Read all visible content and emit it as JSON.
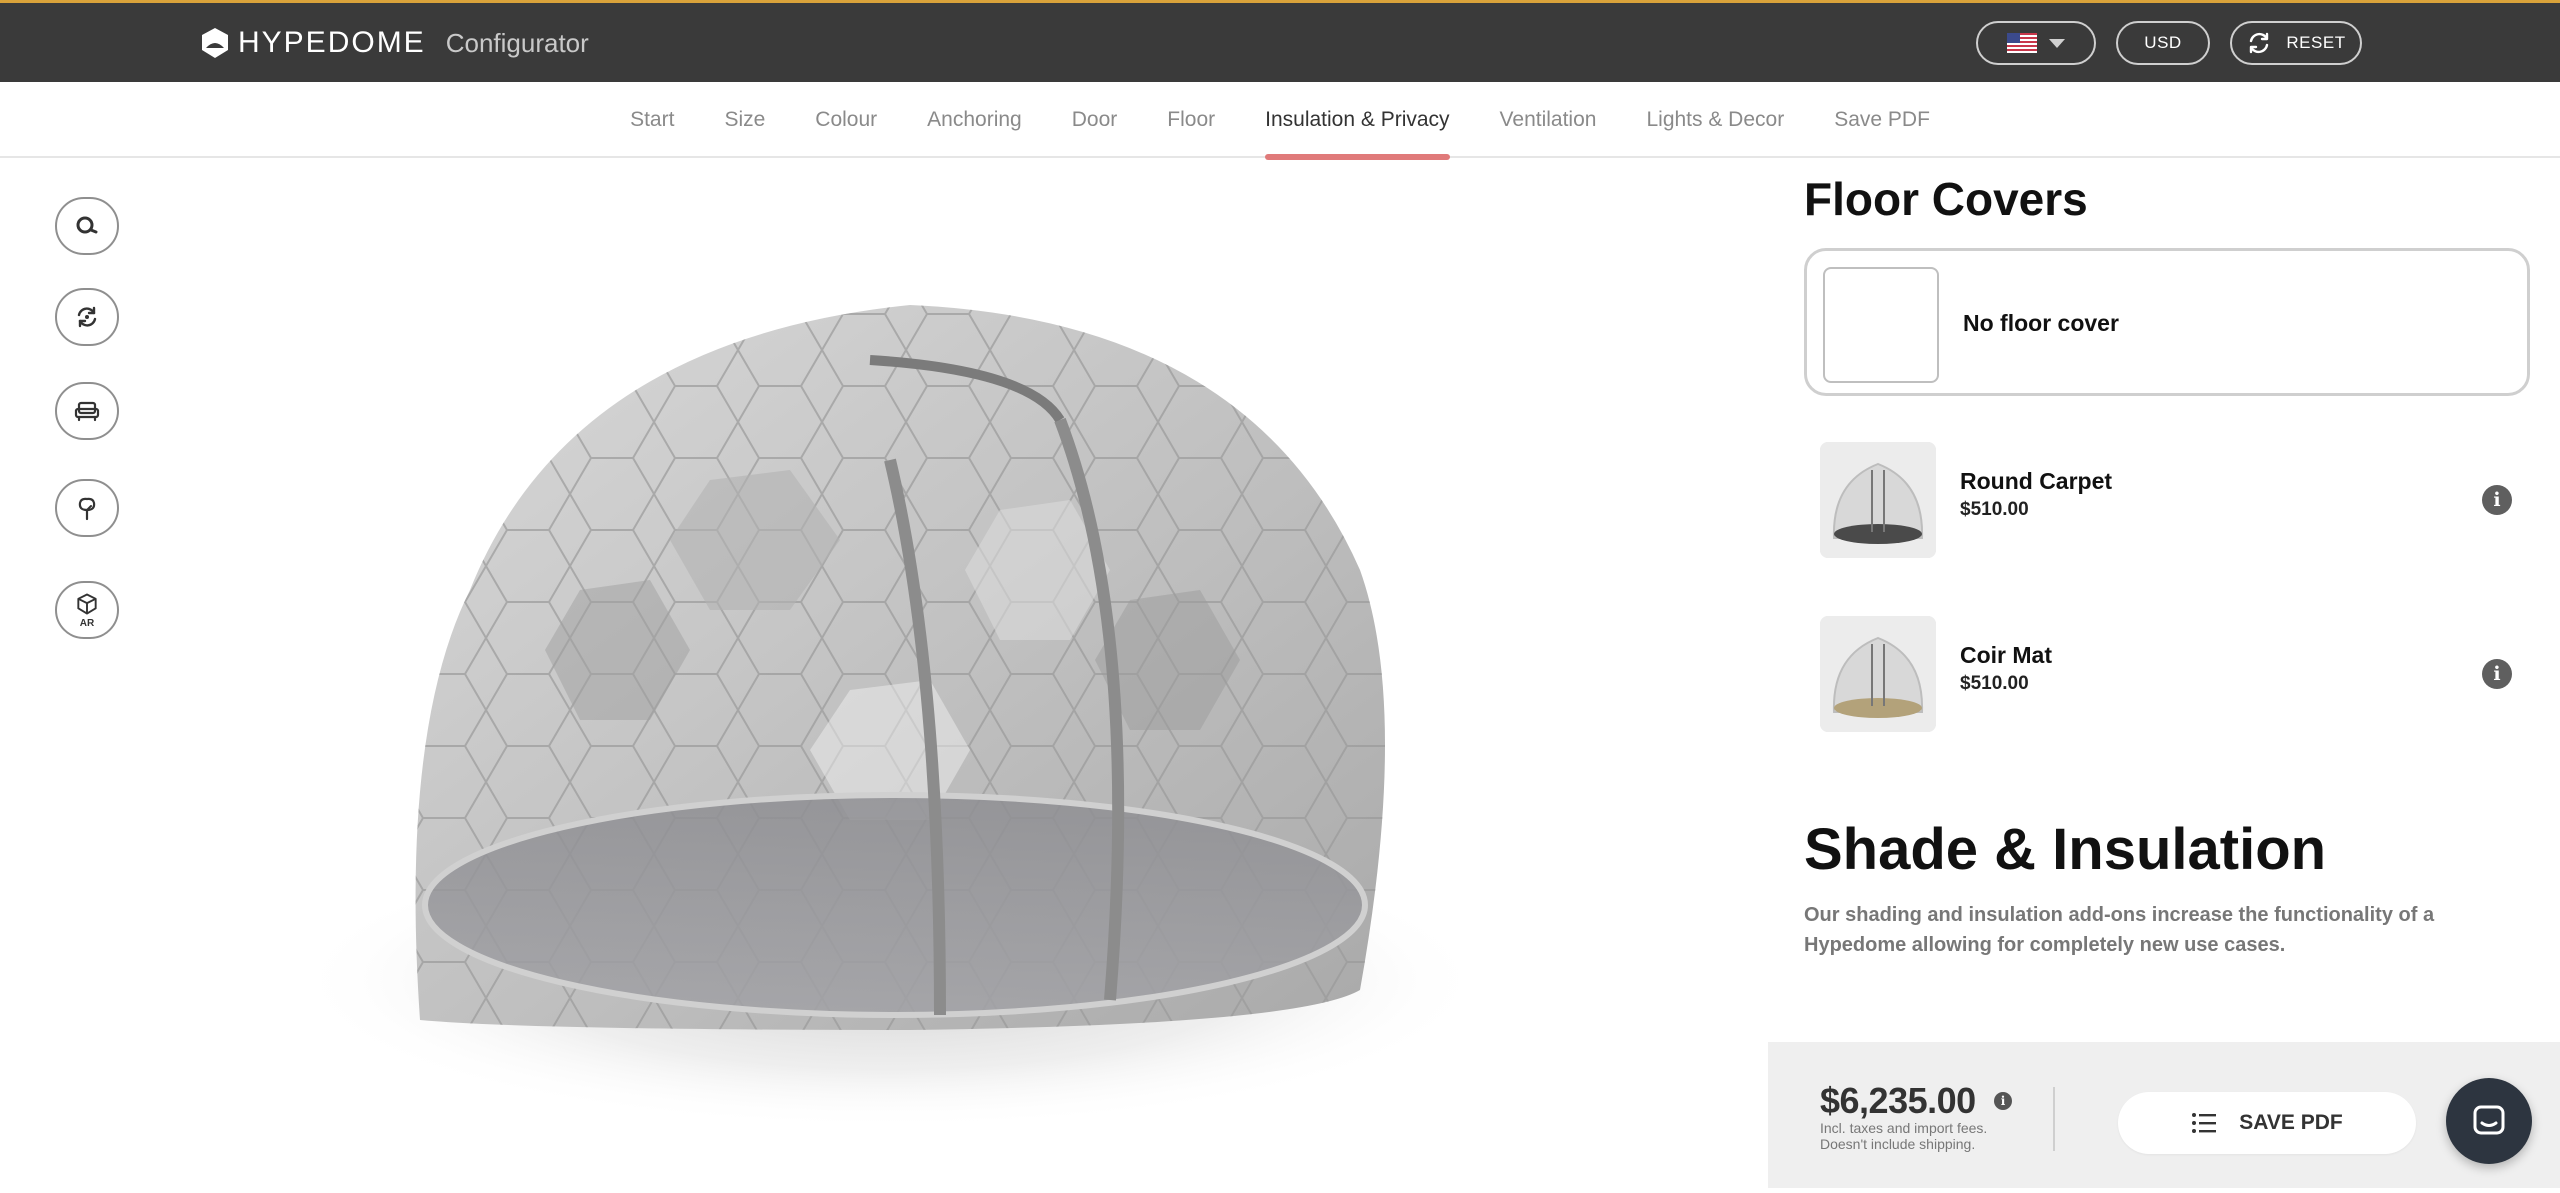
{
  "header": {
    "brand_name": "HYPEDOME",
    "brand_subtitle": "Configurator",
    "country_icon": "us-flag-icon",
    "currency": "USD",
    "reset_label": "RESET",
    "accent_color": "#d9a23a"
  },
  "steps": [
    {
      "label": "Start"
    },
    {
      "label": "Size"
    },
    {
      "label": "Colour"
    },
    {
      "label": "Anchoring"
    },
    {
      "label": "Door"
    },
    {
      "label": "Floor"
    },
    {
      "label": "Insulation & Privacy",
      "active": true
    },
    {
      "label": "Ventilation"
    },
    {
      "label": "Lights & Decor"
    },
    {
      "label": "Save PDF"
    }
  ],
  "tools": {
    "ar_label": "AR"
  },
  "floor_covers": {
    "title": "Floor Covers",
    "options": [
      {
        "name": "No floor cover",
        "selected": true
      },
      {
        "name": "Round Carpet",
        "price": "$510.00"
      },
      {
        "name": "Coir Mat",
        "price": "$510.00"
      }
    ]
  },
  "shade": {
    "title": "Shade & Insulation",
    "description": "Our shading and insulation add-ons increase the functionality of a Hypedome allowing for completely new use cases."
  },
  "footer": {
    "price": "$6,235.00",
    "note_line1": "Incl. taxes and import fees.",
    "note_line2": "Doesn't include shipping.",
    "save_label": "SAVE PDF"
  },
  "active_step_color": "#e07a7a"
}
